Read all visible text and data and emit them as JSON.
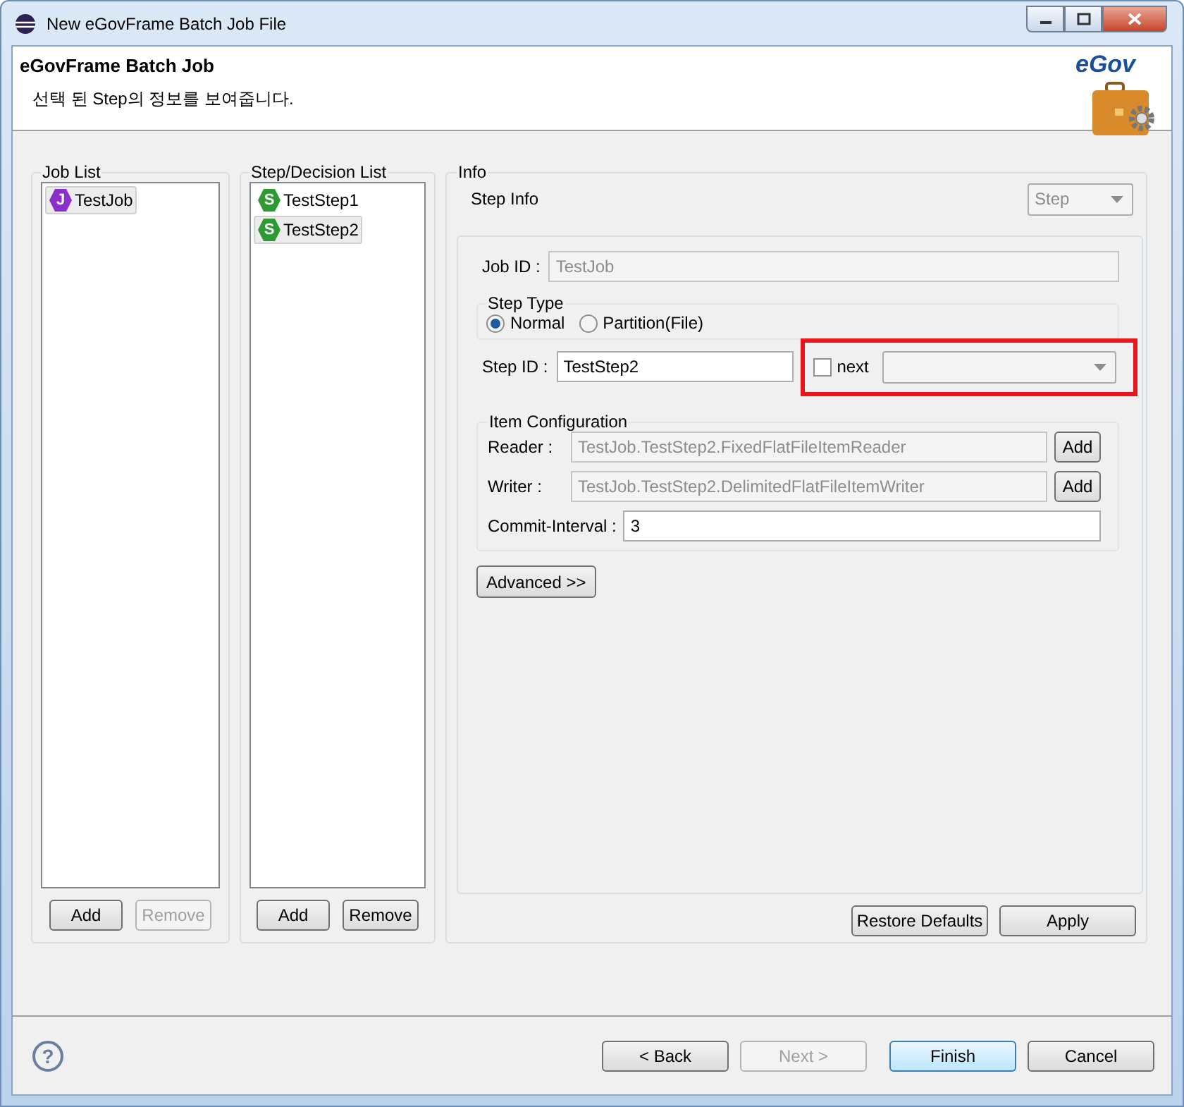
{
  "window": {
    "title": "New eGovFrame Batch Job File"
  },
  "header": {
    "title": "eGovFrame Batch Job",
    "description": "선택 된 Step의 정보를 보여줍니다.",
    "logo_text": "eGov"
  },
  "job_list": {
    "label": "Job List",
    "items": [
      {
        "label": "TestJob",
        "badge": "J",
        "kind": "job",
        "selected": true
      }
    ],
    "buttons": [
      {
        "label": "Add",
        "disabled": false
      },
      {
        "label": "Remove",
        "disabled": true
      }
    ]
  },
  "step_list": {
    "label": "Step/Decision List",
    "items": [
      {
        "label": "TestStep1",
        "badge": "S",
        "kind": "step",
        "selected": false
      },
      {
        "label": "TestStep2",
        "badge": "S",
        "kind": "step",
        "selected": true
      }
    ],
    "buttons": [
      {
        "label": "Add",
        "disabled": false
      },
      {
        "label": "Remove",
        "disabled": false
      }
    ]
  },
  "info": {
    "label": "Info",
    "subtitle": "Step Info",
    "type_combo": {
      "value": "Step",
      "disabled": true
    },
    "job_id": {
      "label": "Job ID :",
      "value": "TestJob",
      "disabled": true
    },
    "step_type": {
      "label": "Step Type",
      "options": [
        {
          "label": "Normal",
          "selected": true
        },
        {
          "label": "Partition(File)",
          "selected": false
        }
      ]
    },
    "step_id": {
      "label": "Step ID :",
      "value": "TestStep2"
    },
    "next": {
      "label": "next",
      "checked": false,
      "highlighted": true
    },
    "item_config": {
      "label": "Item Configuration",
      "rows": [
        {
          "label": "Reader :",
          "value": "TestJob.TestStep2.FixedFlatFileItemReader",
          "button": "Add"
        },
        {
          "label": "Writer :",
          "value": "TestJob.TestStep2.DelimitedFlatFileItemWriter",
          "button": "Add"
        }
      ],
      "commit_interval": {
        "label": "Commit-Interval :",
        "value": "3"
      }
    },
    "advanced_button": "Advanced >>",
    "buttons": [
      {
        "label": "Restore Defaults"
      },
      {
        "label": "Apply"
      }
    ]
  },
  "footer": {
    "help": "?",
    "buttons": [
      {
        "label": "< Back",
        "disabled": false,
        "default": false
      },
      {
        "label": "Next >",
        "disabled": true,
        "default": false
      },
      {
        "label": "Finish",
        "disabled": false,
        "default": true
      },
      {
        "label": "Cancel",
        "disabled": false,
        "default": false
      }
    ]
  }
}
